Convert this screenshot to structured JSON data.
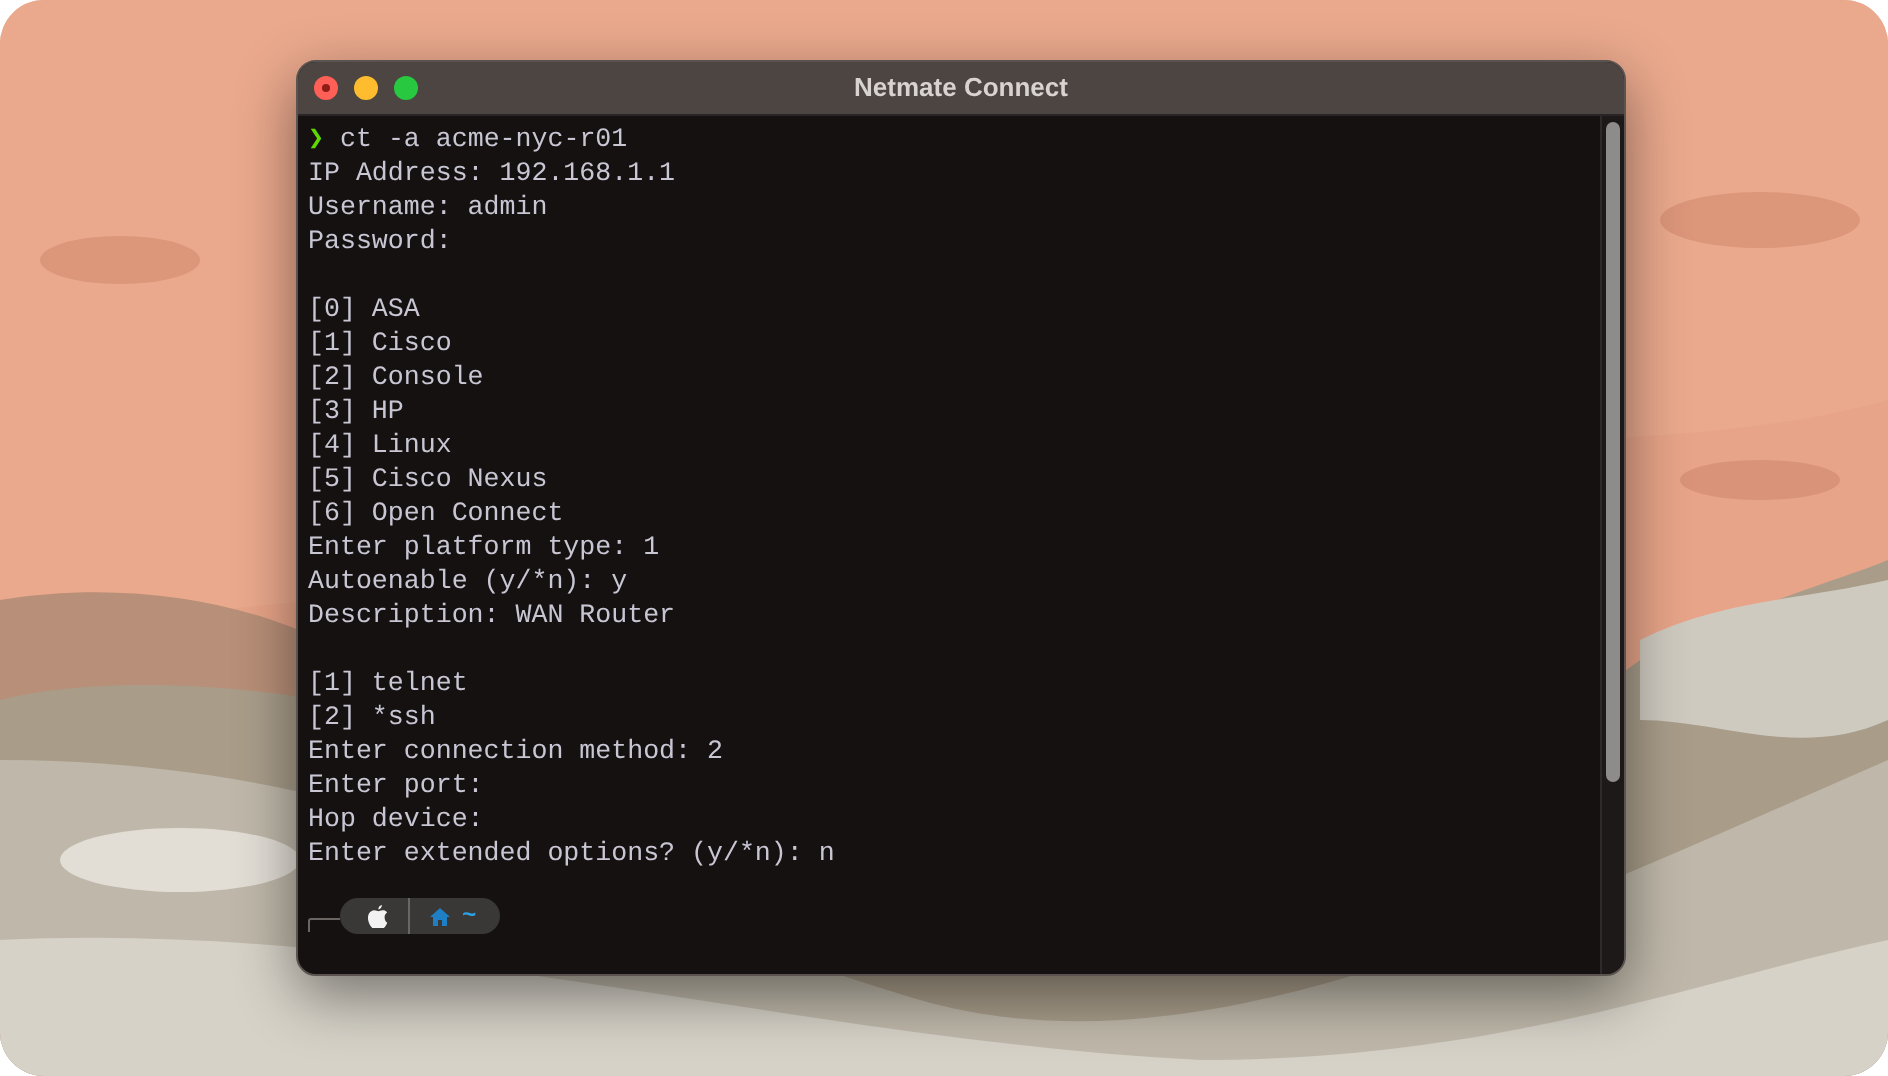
{
  "window": {
    "title": "Netmate Connect"
  },
  "terminal": {
    "prompt": {
      "symbol": "❯",
      "command": "ct -a acme-nyc-r01"
    },
    "blocks": [
      [
        "IP Address: 192.168.1.1",
        "Username: admin",
        "Password:"
      ],
      [
        "[0] ASA",
        "[1] Cisco",
        "[2] Console",
        "[3] HP",
        "[4] Linux",
        "[5] Cisco Nexus",
        "[6] Open Connect",
        "Enter platform type: 1",
        "Autoenable (y/*n): y",
        "Description: WAN Router"
      ],
      [
        "[1] telnet",
        "[2] *ssh",
        "Enter connection method: 2",
        "Enter port:",
        "Hop device:",
        "Enter extended options? (y/*n): n"
      ]
    ],
    "shell_prompt": {
      "path": "~"
    }
  }
}
